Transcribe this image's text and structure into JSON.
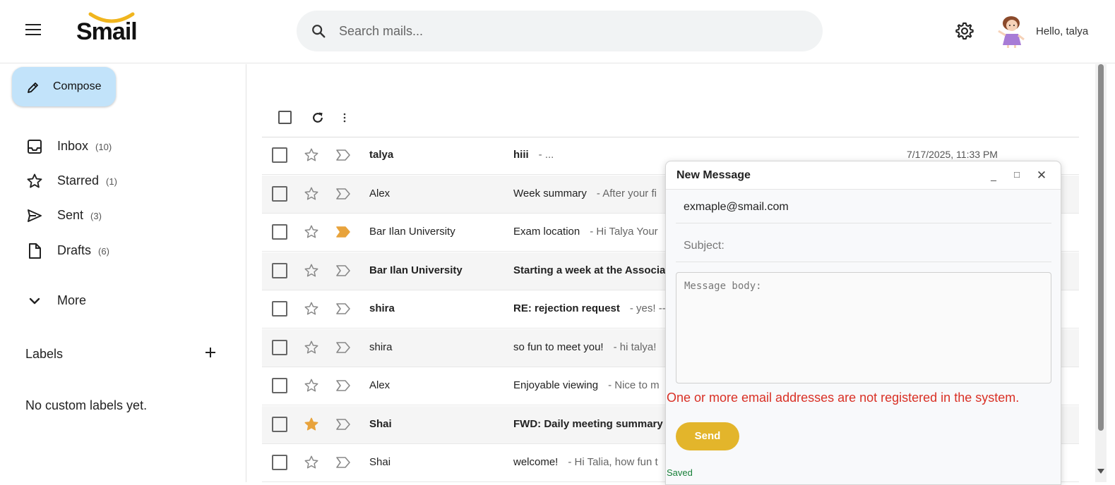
{
  "header": {
    "logo_text": "Smail",
    "search_placeholder": "Search mails...",
    "greeting": "Hello, talya"
  },
  "sidebar": {
    "compose_label": "Compose",
    "items": [
      {
        "label": "Inbox",
        "count": "(10)",
        "icon": "inbox-icon"
      },
      {
        "label": "Starred",
        "count": "(1)",
        "icon": "star-icon"
      },
      {
        "label": "Sent",
        "count": "(3)",
        "icon": "send-icon"
      },
      {
        "label": "Drafts",
        "count": "(6)",
        "icon": "draft-icon"
      }
    ],
    "more_label": "More",
    "labels_title": "Labels",
    "no_labels": "No custom labels yet."
  },
  "mail_list": {
    "rows": [
      {
        "sender": "talya",
        "subject": "hiii",
        "snippet": "- ...",
        "date": "7/17/2025, 11:33 PM",
        "bold": true,
        "starred": false,
        "important": false
      },
      {
        "sender": "Alex",
        "subject": "Week summary",
        "snippet": "- After your fi",
        "date": "",
        "bold": false,
        "starred": false,
        "important": false
      },
      {
        "sender": "Bar Ilan University",
        "subject": "Exam location",
        "snippet": "- Hi Talya Your",
        "date": "",
        "bold": false,
        "starred": false,
        "important": true
      },
      {
        "sender": "Bar Ilan University",
        "subject": "Starting a week at the Associat",
        "snippet": "",
        "date": "",
        "bold": true,
        "starred": false,
        "important": false
      },
      {
        "sender": "shira",
        "subject": "RE: rejection request",
        "snippet": "- yes! ---",
        "date": "",
        "bold": true,
        "starred": false,
        "important": false
      },
      {
        "sender": "shira",
        "subject": "so fun to meet you!",
        "snippet": "- hi talya!",
        "date": "",
        "bold": false,
        "starred": false,
        "important": false
      },
      {
        "sender": "Alex",
        "subject": "Enjoyable viewing",
        "snippet": "- Nice to m",
        "date": "",
        "bold": false,
        "starred": false,
        "important": false
      },
      {
        "sender": "Shai",
        "subject": "FWD: Daily meeting summary",
        "snippet": "",
        "date": "",
        "bold": true,
        "starred": true,
        "important": false
      },
      {
        "sender": "Shai",
        "subject": "welcome!",
        "snippet": "- Hi Talia, how fun t",
        "date": "",
        "bold": false,
        "starred": false,
        "important": false
      }
    ]
  },
  "compose_window": {
    "title": "New Message",
    "to_value": "exmaple@smail.com",
    "subject_placeholder": "Subject:",
    "body_placeholder": "Message body:",
    "error": "One or more email addresses are not registered in the system.",
    "send_label": "Send",
    "status": "Saved",
    "minimize_label": "_",
    "maximize_label": "□",
    "close_label": "✕"
  },
  "colors": {
    "accent": "#e3b52b",
    "compose_bg": "#c2e3fa",
    "error": "#d93025",
    "star": "#e8a33c"
  }
}
